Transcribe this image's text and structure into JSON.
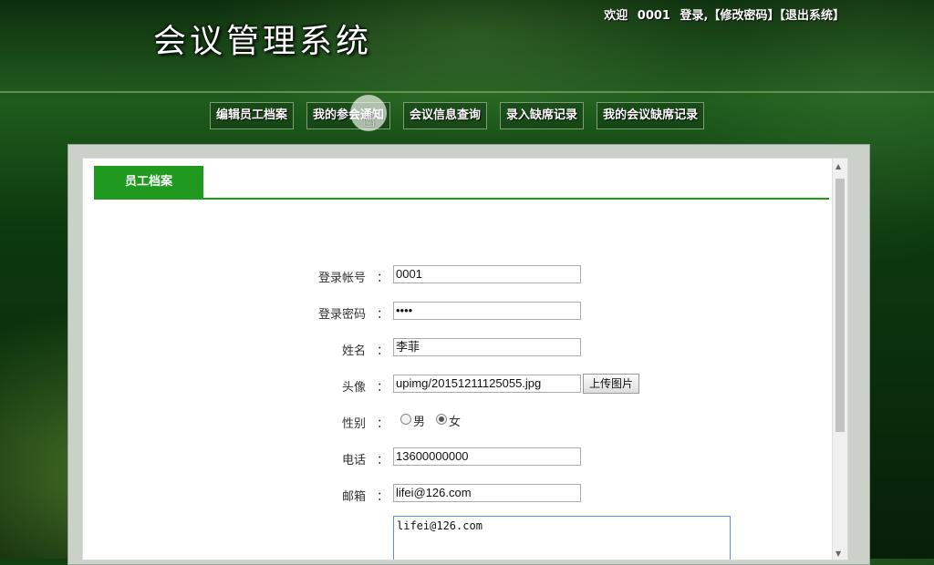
{
  "header": {
    "title": "会议管理系统",
    "welcome": "欢迎",
    "user_id": "0001",
    "logged_in": "登录,",
    "change_password": "【修改密码】",
    "logout": "【退出系统】"
  },
  "nav": {
    "items": [
      "编辑员工档案",
      "我的参会通知",
      "会议信息查询",
      "录入缺席记录",
      "我的会议缺席记录"
    ]
  },
  "panel": {
    "tab_label": "员工档案"
  },
  "form": {
    "account": {
      "label": "登录帐号",
      "value": "0001"
    },
    "password": {
      "label": "登录密码",
      "value": "••••"
    },
    "name": {
      "label": "姓名",
      "value": "李菲"
    },
    "avatar": {
      "label": "头像",
      "value": "upimg/20151211125055.jpg",
      "upload_label": "上传图片"
    },
    "gender": {
      "label": "性别",
      "options": [
        "男",
        "女"
      ],
      "selected": "女"
    },
    "phone": {
      "label": "电话",
      "value": "13600000000"
    },
    "email": {
      "label": "邮箱",
      "value": "lifei@126.com"
    },
    "notes": {
      "value": "lifei@126.com"
    },
    "colon": "："
  },
  "colors": {
    "accent": "#1f9a1f"
  },
  "icons": {
    "cursor": "pointer-hand-icon"
  }
}
